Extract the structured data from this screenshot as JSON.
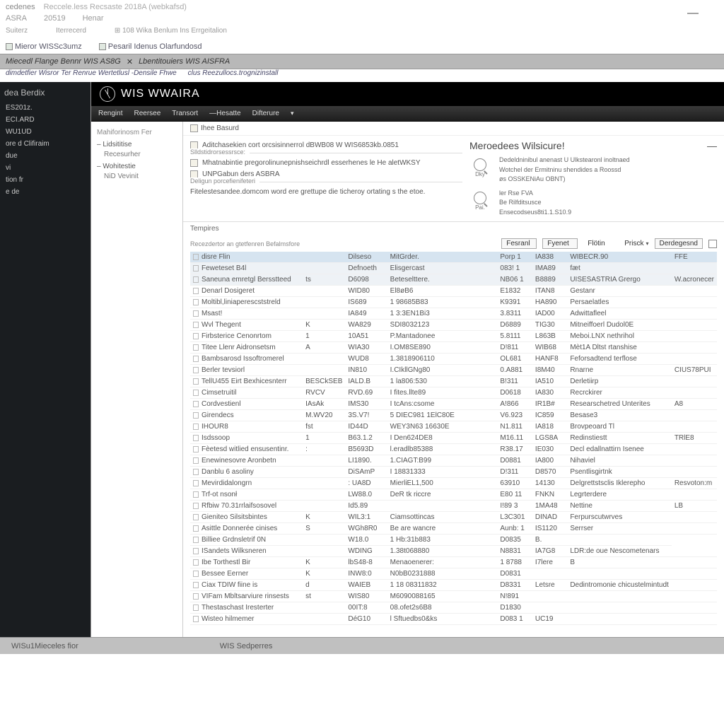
{
  "top": {
    "t1": "cedenes",
    "t2": "Reccele.less Recsaste 2018A (webkafsd)",
    "r2a": "ASRA",
    "r2b": "20519",
    "r2c": "Henar",
    "r3a": "Suiterz",
    "r3b": "Iterrecerd",
    "r3c": "⊞ 108 Wika Benlum Ins Errgeitalion"
  },
  "minimize": "—",
  "tabs": {
    "t1": "Mieror WISSc3umz",
    "t2": "Pesaril Idenus Olarfundosd"
  },
  "grey_title": {
    "a": "Miecedl Flange Bennr WIS AS8G",
    "x": "✕",
    "b": "Lbentitouiers WIS AISFRA"
  },
  "links": {
    "l1": "dimdetfier Wisror Ter Renrue Wertetlusl -Densile Fhwe",
    "l2": "clus Reezullocs.trognizinstall"
  },
  "sidebar": {
    "hdr": "dea Berdix",
    "items": [
      "ES201z.",
      "ECI.ARD",
      "WU1UD",
      "ore d Clifiraim",
      "due",
      "vi",
      "tion fr",
      "e de"
    ]
  },
  "brand": "WIS WWAIRA",
  "menu": {
    "m1": "Rengint",
    "m2": "Reersee",
    "m3": "Transort",
    "m4": "—Hesatte",
    "m5": "Difterure"
  },
  "nav": {
    "lbl": "Mahiforinosm Fer",
    "g1": "Lidsititise",
    "g1s": "Recesurher",
    "g2": "Wohitestie",
    "g2s": "NiD Vevinit"
  },
  "crumb": {
    "text": "Ihee Basurd"
  },
  "header": {
    "row1": "Aditchasekien cort orcsisinnerrol dBWB08 W WIS6853kb.0851",
    "sep1": "Slldstidrorsessrsce:",
    "row2": "Mhatnabintie pregorolinunepnishseichrdl esserhenes le He aletWKSY",
    "row3": "UNPGabun ders ASBRA",
    "sep2": "Deligun porcefienifeteri",
    "row4": "Fitelestesandee.domcom word ere grettupe die ticheroy ortating s the etoe."
  },
  "panel_right": {
    "title": "Meroedees Wilsicure!",
    "ico1": "Dky",
    "ico2": "Pai.",
    "info1a": "Dedeldninibul anenast U Ulkstearonl inoltnaed",
    "info1b": "Wotchel der Ermitninu shendides a Roossd",
    "info1c": "øs OSSKENiAu OBNT)",
    "info2a": "ler Rse FVA",
    "info2b": "Be Rilfditsusce",
    "info2c": "Ensecodseus8ti1.1.S10.9"
  },
  "table_controls": {
    "lbl": "Tempires",
    "desc_label": "Recezdertor an gtetfenren Befalmsfore",
    "s1": "Fesranl",
    "s2": "Fyenet",
    "s3": "Flötin",
    "sort": "Prisck",
    "sort_caret": "▾",
    "chk": "Derdegesnd"
  },
  "cols": [
    "",
    "",
    "",
    "",
    "",
    "",
    "",
    ""
  ],
  "rows": [
    {
      "sel": true,
      "c": [
        "disre Flin",
        "",
        "Dilseso",
        "MitGrder.",
        "",
        "Porp 1",
        "IA838",
        "WIBECR.90",
        "FFE"
      ]
    },
    {
      "alt": true,
      "c": [
        "Feweteset B4l",
        "",
        "Defnoeth",
        "Elisgercast",
        "",
        "083! 1",
        "IMA89",
        "fæt",
        ""
      ]
    },
    {
      "alt": true,
      "c": [
        "Saneuna emretgl Bersstteed",
        "ts",
        "D6098",
        "Beteselttere.",
        "",
        "NB06 1",
        "B8889",
        "UISESASTRIA Grergo",
        "W.acronecer"
      ]
    },
    {
      "c": [
        "Denarl Dosigeret",
        "",
        "WID80",
        "El8øB6",
        "",
        "E1832",
        "ITAN8",
        "Gestanr",
        ""
      ]
    },
    {
      "c": [
        "Moltibl,liniaperescststreld",
        "",
        "IS689",
        "1 98685B83",
        "",
        "K9391",
        "HA890",
        "Persaelatles",
        ""
      ]
    },
    {
      "c": [
        "Msast!",
        "",
        "IA849",
        "1 3:3EN1Bi3",
        "",
        "3.8311",
        "IAD00",
        "Adwittafleel",
        ""
      ]
    },
    {
      "c": [
        "Wvl Thegent",
        "K",
        "WA829",
        "SDI8032123",
        "",
        "D6889",
        "TIG30",
        "Mitneiffoerl Dudol0E",
        ""
      ]
    },
    {
      "c": [
        "Firbsterice Cenonrtom",
        "1",
        "10A51",
        "P.Mantadonee",
        "",
        "5.8111",
        "L863B",
        "Meboi.LNX nethrihol",
        ""
      ]
    },
    {
      "c": [
        "Titee Llenr Aidronsetsm",
        "A",
        "WIA30",
        "I.OM8SE890",
        "",
        "D!811",
        "WIB68",
        "Mèt1A Dltst rtanshise",
        ""
      ]
    },
    {
      "c": [
        "Bambsarosd Issoftromerel",
        "",
        "WUD8",
        "1.3818906110",
        "",
        "OL681",
        "HANF8",
        "Feforsadtend terflose",
        ""
      ]
    },
    {
      "c": [
        "Berler tevsiorl",
        "",
        "IN810",
        "I.CIkllGNg80",
        "",
        "0.A881",
        "I8M40",
        "Rnarne",
        "CIUS78PUI"
      ]
    },
    {
      "c": [
        "TellU455 Eirt Bexhicesnterr",
        "BESCkSEB",
        "IALD.B",
        "1 la806:530",
        "",
        "B!311",
        "IA510",
        "Derletiirp",
        ""
      ]
    },
    {
      "c": [
        "Cimsetruitil",
        "RVCV",
        "RVD.69",
        "I fites.llte89",
        "",
        "D0618",
        "IA830",
        "Recrckirer",
        ""
      ]
    },
    {
      "c": [
        "Cordvestienl",
        "IAsAk",
        "IMS30",
        "I tcAns:csome",
        "",
        "A!866",
        "IR1B#",
        "Researschetred Unterites",
        "A8"
      ]
    },
    {
      "c": [
        "Girendecs",
        "M.WV20",
        "3S.V7!",
        "5 DIEC981 1ElC80E",
        "",
        "V6.923",
        "IC859",
        "Besase3",
        ""
      ]
    },
    {
      "c": [
        "IHOUR8",
        "fst",
        "ID44D",
        "WEY3N63 16630E",
        "",
        "N1.811",
        "IA818",
        "Brovpeoard Tl",
        ""
      ]
    },
    {
      "c": [
        "Isdssoop",
        "1",
        "B63.1.2",
        "I Den624DE8",
        "",
        "M16.11",
        "LGS8A",
        "Redinstiestt",
        "TRlE8"
      ]
    },
    {
      "c": [
        "Fèetesd witlied ensusentinr.",
        ": ",
        "B5693D",
        "l.eradlb85388",
        "",
        "R38.17",
        "IE030",
        "Decl edallnattirn Isenee",
        ""
      ]
    },
    {
      "c": [
        "Enewinesovre Aronbetn",
        "",
        "LI1890.",
        "1.CIAGT:B99",
        "",
        "D0881",
        "IA800",
        "Nihaviel",
        ""
      ]
    },
    {
      "c": [
        "Danblu 6 asoliny",
        "",
        "DiSAmP",
        "I 18831333",
        "",
        "D!311",
        "D8570",
        "Psentlisgirtnk",
        ""
      ]
    },
    {
      "c": [
        "Mevirdidalongrn",
        "",
        ": UA8D",
        "MierliEL1,500",
        "",
        "63910",
        "14130",
        "Delgrettstsclis Iklerepho",
        "Resvoton:m"
      ]
    },
    {
      "c": [
        "Trf-ot nsonł",
        "",
        "LW88.0",
        "DeR tk riccre",
        "",
        "E80 11",
        "FNKN",
        "Legrterdere",
        ""
      ]
    },
    {
      "c": [
        "Rfbiw 70.31rrlaifsosovel",
        "",
        "Id5.89",
        "",
        "",
        "I!89 3",
        "1MA48",
        "Nettine",
        "LB"
      ]
    },
    {
      "c": [
        "Gieniteo Silsitsbintes",
        "K",
        "WIL3:1",
        "Ciamsottincas",
        "",
        "L3C301",
        "DINAD",
        "Ferpurscutwrves",
        ""
      ]
    },
    {
      "c": [
        "Asittle Donnerée cinises",
        "S",
        "WGh8R0",
        "Be are wancre",
        "",
        "Aunb: 1",
        "IS1120",
        "Serrser",
        ""
      ]
    },
    {
      "c": [
        "Billiee Grdnsletrif 0N",
        "",
        "W18.0",
        "1 Hb:31b883",
        "",
        "D0835",
        "B.",
        ""
      ]
    },
    {
      "c": [
        "ISandets Wilksneren",
        "",
        "WDING",
        "1.38t068880",
        "",
        "N8831",
        "IA7G8",
        "LDR:de oue Nescometenars",
        ""
      ]
    },
    {
      "c": [
        "Ibe Torthestl Bir",
        "K",
        "lbS48-8",
        "Menaoenerer:",
        "",
        "1 8788",
        "I7lere",
        "B",
        ""
      ]
    },
    {
      "c": [
        "Bessee Eerner",
        "K",
        "INW8:0",
        "N0bB0231888",
        "",
        "D0831",
        "",
        "",
        ""
      ]
    },
    {
      "c": [
        "Ciax TDIW fiine is",
        "d",
        "WAIEB",
        "1 18 08311832",
        "",
        "D8331",
        "Letsre",
        "Dedintromonie chicustelmintudt",
        ""
      ]
    },
    {
      "c": [
        "VIFam Mbltsarviure rinsests",
        "st",
        "WIS80",
        "M6090088165",
        "",
        "N!891",
        "",
        "",
        ""
      ]
    },
    {
      "c": [
        "Thestaschast Iresterter",
        "",
        "00IT:8",
        "08.ofet2s6B8",
        "",
        "D1830",
        "",
        "",
        ""
      ]
    },
    {
      "c": [
        "Wisteo hilmemer",
        "",
        "DéG10",
        "l Sftuedbs0&ks",
        "",
        "D083 1",
        "UC19",
        "",
        ""
      ]
    }
  ],
  "status": {
    "a": "WISu1Mieceles fior",
    "b": "WIS Sedperres"
  }
}
